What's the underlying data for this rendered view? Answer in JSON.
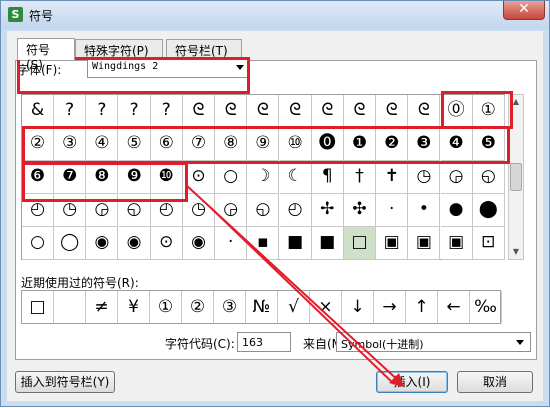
{
  "window": {
    "title": "符号",
    "app_icon": "S",
    "close_glyph": "✕"
  },
  "tabs": [
    {
      "label": "符号(S)"
    },
    {
      "label": "特殊字符(P)"
    },
    {
      "label": "符号栏(T)"
    }
  ],
  "font": {
    "label": "字体(F):",
    "value": "Wingdings 2"
  },
  "grid": {
    "rows": [
      [
        "&",
        "?",
        "?",
        "?",
        "?",
        "ᘓ",
        "ᘓ",
        "ᘓ",
        "ᘓ",
        "ᘓ",
        "ᘓ",
        "ᘓ",
        "ᘓ",
        "⓪",
        "①"
      ],
      [
        "②",
        "③",
        "④",
        "⑤",
        "⑥",
        "⑦",
        "⑧",
        "⑨",
        "⑩",
        "⓿",
        "❶",
        "❷",
        "❸",
        "❹",
        "❺"
      ],
      [
        "❻",
        "❼",
        "❽",
        "❾",
        "❿",
        "⊙",
        "○",
        "☽",
        "☾",
        "¶",
        "†",
        "✝",
        "◷",
        "◶",
        "◵"
      ],
      [
        "◴",
        "◷",
        "◶",
        "◵",
        "◴",
        "◷",
        "◶",
        "◵",
        "◴",
        "✢",
        "✣",
        "·",
        "•",
        "●",
        "⬤"
      ],
      [
        "○",
        "◯",
        "◉",
        "◉",
        "⊙",
        "◉",
        "·",
        "▪",
        "■",
        "■",
        "□",
        "▣",
        "▣",
        "▣",
        "⊡"
      ]
    ]
  },
  "recent": {
    "label": "近期使用过的符号(R):",
    "items": [
      "□",
      "",
      "≠",
      "¥",
      "①",
      "②",
      "③",
      "№",
      "√",
      "×",
      "↓",
      "→",
      "↑",
      "←",
      "‰"
    ]
  },
  "code": {
    "label": "字符代码(C):",
    "value": "163",
    "from_label": "来自(M)",
    "from_value": "Symbol(十进制)"
  },
  "buttons": {
    "insert_to_bar": "插入到符号栏(Y)",
    "insert": "插入(I)",
    "cancel": "取消"
  },
  "colors": {
    "highlight": "#e21d2b",
    "selected_cell": "#cfe0c9"
  }
}
